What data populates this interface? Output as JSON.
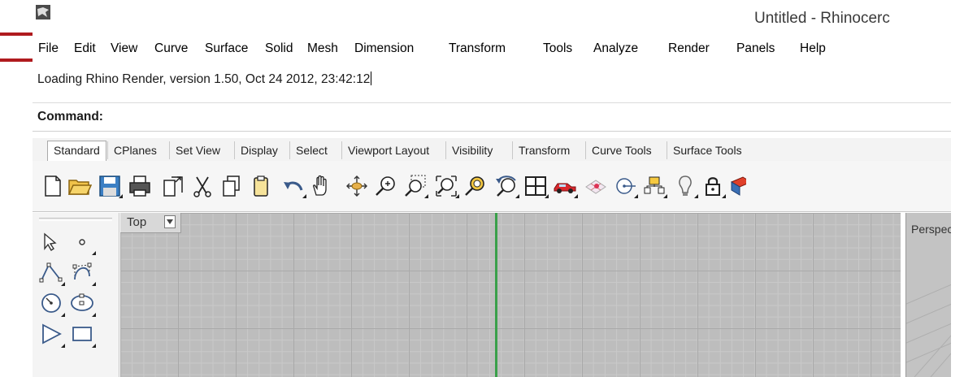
{
  "window": {
    "title": "Untitled - Rhinocerc"
  },
  "menubar": {
    "items": [
      "File",
      "Edit",
      "View",
      "Curve",
      "Surface",
      "Solid",
      "Mesh",
      "Dimension",
      "Transform",
      "Tools",
      "Analyze",
      "Render",
      "Panels",
      "Help"
    ]
  },
  "command": {
    "history": "Loading Rhino Render, version 1.50, Oct 24 2012, 23:42:12",
    "prompt_label": "Command:"
  },
  "toolbar_tabs": [
    "Standard",
    "CPlanes",
    "Set View",
    "Display",
    "Select",
    "Viewport Layout",
    "Visibility",
    "Transform",
    "Curve Tools",
    "Surface Tools"
  ],
  "toolbar_icons": [
    "new-file-icon",
    "open-folder-icon",
    "save-icon",
    "print-icon",
    "import-icon",
    "cut-icon",
    "copy-icon",
    "paste-icon",
    "undo-icon",
    "pan-hand-icon",
    "rotate-view-icon",
    "zoom-icon",
    "zoom-window-icon",
    "zoom-extents-icon",
    "zoom-selected-icon",
    "undo-view-icon",
    "four-viewports-icon",
    "car-render-icon",
    "grid-snap-icon",
    "osnap-icon",
    "properties-icon",
    "bulb-light-icon",
    "lock-icon",
    "render-material-icon"
  ],
  "sidebar_icons": [
    "select-arrow-icon",
    "point-icon",
    "polyline-icon",
    "curve-cv-icon",
    "circle-icon",
    "ellipse-icon",
    "polygon-icon",
    "rectangle-icon"
  ],
  "viewports": {
    "top": {
      "label": "Top"
    },
    "perspective": {
      "label": "Perspect"
    }
  },
  "colors": {
    "highlight": "#b01a1e",
    "x_axis_green": "#3aa04a",
    "viewport_bg": "#bdbdbd"
  }
}
